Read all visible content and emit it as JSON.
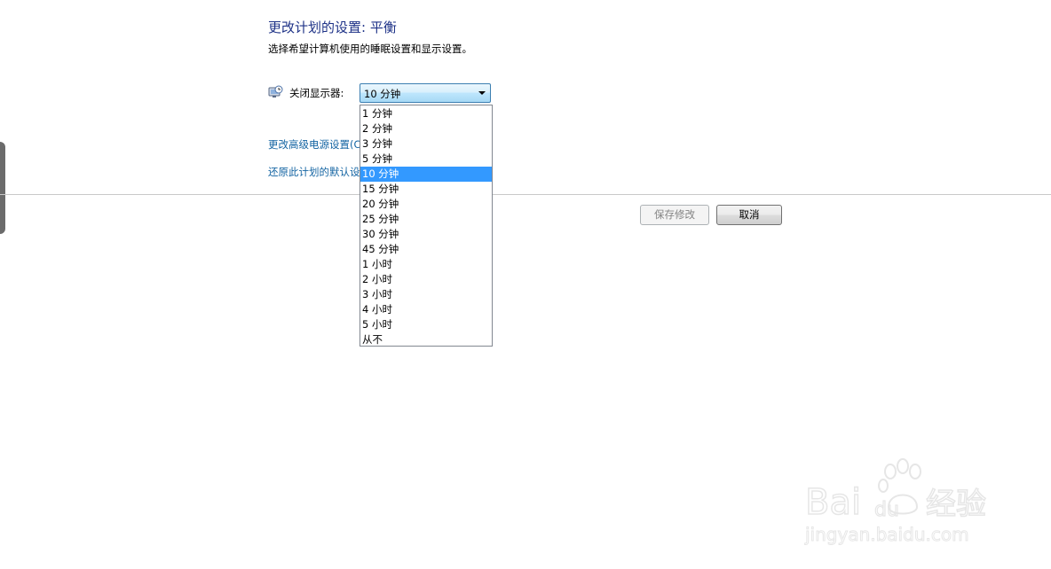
{
  "header": {
    "title": "更改计划的设置: 平衡",
    "subtitle": "选择希望计算机使用的睡眠设置和显示设置。"
  },
  "display_setting": {
    "label": "关闭显示器:",
    "icon": "monitor-clock-icon",
    "selected_value": "10 分钟",
    "options": [
      "1 分钟",
      "2 分钟",
      "3 分钟",
      "5 分钟",
      "10 分钟",
      "15 分钟",
      "20 分钟",
      "25 分钟",
      "30 分钟",
      "45 分钟",
      "1 小时",
      "2 小时",
      "3 小时",
      "4 小时",
      "5 小时",
      "从不"
    ],
    "selected_index": 4
  },
  "links": {
    "advanced": "更改高级电源设置(C)",
    "restore": "还原此计划的默认设置"
  },
  "buttons": {
    "save": "保存修改",
    "cancel": "取消"
  },
  "watermark": {
    "brand": "Bai du 经验",
    "url": "jingyan.baidu.com"
  },
  "colors": {
    "title": "#1e3287",
    "link": "#1565a3",
    "selection": "#3399ff"
  }
}
